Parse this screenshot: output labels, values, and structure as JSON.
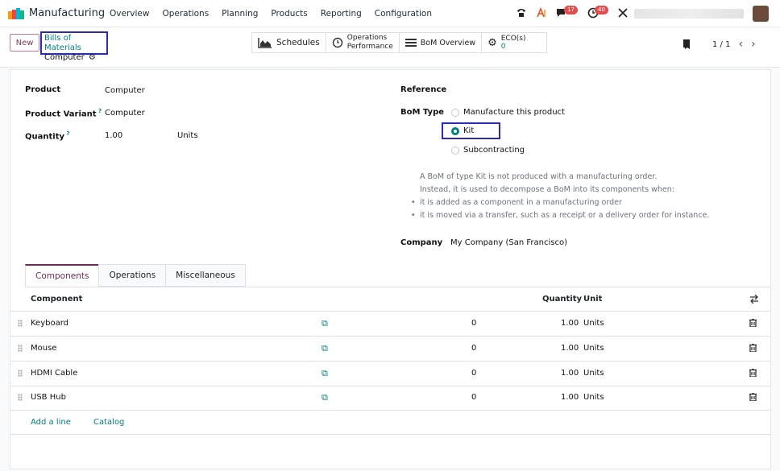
{
  "navbar": {
    "app_name": "Manufacturing",
    "menu": [
      "Overview",
      "Operations",
      "Planning",
      "Products",
      "Reporting",
      "Configuration"
    ],
    "messages_count": "17",
    "activities_count": "40"
  },
  "control_panel": {
    "new_label": "New",
    "breadcrumb_parent": "Bills of Materials",
    "breadcrumb_current": "Computer",
    "smart_buttons": {
      "schedules": "Schedules",
      "operations_perf_1": "Operations",
      "operations_perf_2": "Performance",
      "bom_overview": "BoM Overview",
      "eco_label": "ECO(s)",
      "eco_count": "0"
    },
    "pager": "1 / 1"
  },
  "form": {
    "product_label": "Product",
    "product_value": "Computer",
    "variant_label": "Product Variant",
    "variant_value": "Computer",
    "quantity_label": "Quantity",
    "quantity_value": "1.00",
    "quantity_uom": "Units",
    "reference_label": "Reference",
    "bom_type_label": "BoM Type",
    "bom_type_options": [
      "Manufacture this product",
      "Kit",
      "Subcontracting"
    ],
    "bom_type_selected": "Kit",
    "kit_note_1": "A BoM of type Kit is not produced with a manufacturing order.",
    "kit_note_2": "Instead, it is used to decompose a BoM into its components when:",
    "kit_note_3": "it is added as a component in a manufacturing order",
    "kit_note_4": "it is moved via a transfer, such as a receipt or a delivery order for instance.",
    "company_label": "Company",
    "company_value": "My Company (San Francisco)"
  },
  "tabs": [
    "Components",
    "Operations",
    "Miscellaneous"
  ],
  "table": {
    "headers": {
      "component": "Component",
      "quantity": "Quantity",
      "unit": "Unit"
    },
    "rows": [
      {
        "component": "Keyboard",
        "count": "0",
        "quantity": "1.00",
        "unit": "Units"
      },
      {
        "component": "Mouse",
        "count": "0",
        "quantity": "1.00",
        "unit": "Units"
      },
      {
        "component": "HDMI Cable",
        "count": "0",
        "quantity": "1.00",
        "unit": "Units"
      },
      {
        "component": "USB Hub",
        "count": "0",
        "quantity": "1.00",
        "unit": "Units"
      }
    ],
    "add_line": "Add a line",
    "catalog": "Catalog"
  }
}
